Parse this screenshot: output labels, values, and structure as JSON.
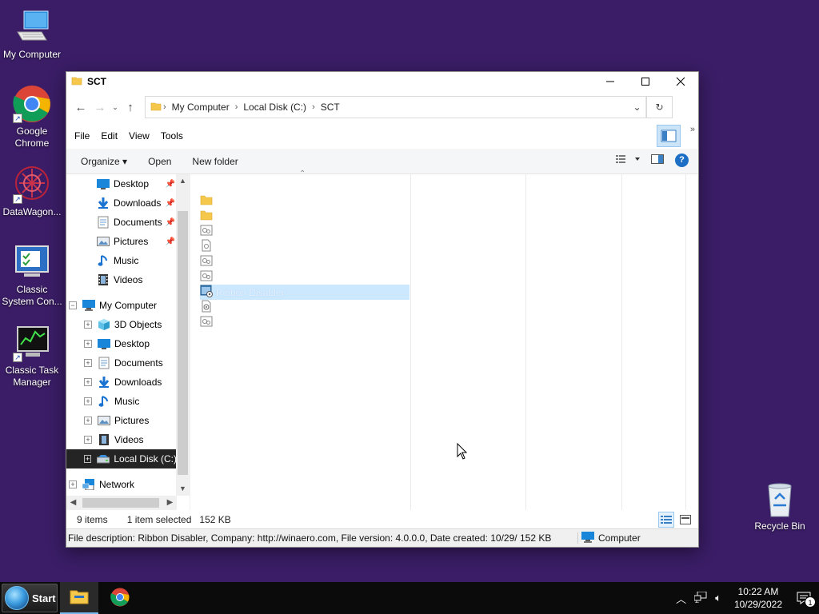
{
  "desktop": {
    "icons": [
      {
        "label": "My Computer",
        "icon": "computer-icon"
      },
      {
        "label": "Google Chrome",
        "icon": "chrome-icon"
      },
      {
        "label": "DataWagon...",
        "icon": "datawagon-icon"
      },
      {
        "label": "Classic System Con...",
        "icon": "control-panel-icon"
      },
      {
        "label": "Classic Task Manager",
        "icon": "task-manager-icon"
      },
      {
        "label": "Recycle Bin",
        "icon": "recycle-bin-icon"
      }
    ]
  },
  "window": {
    "title": "SCT",
    "controls": {
      "minimize": "—",
      "maximize": "☐",
      "close": "✕"
    },
    "address": {
      "crumbs": [
        "My Computer",
        "Local Disk (C:)",
        "SCT"
      ]
    },
    "menu": [
      "File",
      "Edit",
      "View",
      "Tools"
    ],
    "commands": {
      "organize": "Organize",
      "open": "Open",
      "new_folder": "New folder"
    },
    "nav": {
      "quick_access": [
        {
          "label": "Desktop",
          "icon": "desktop-icon",
          "pinned": true
        },
        {
          "label": "Downloads",
          "icon": "downloads-icon",
          "pinned": true
        },
        {
          "label": "Documents",
          "icon": "documents-icon",
          "pinned": true
        },
        {
          "label": "Pictures",
          "icon": "pictures-icon",
          "pinned": true
        },
        {
          "label": "Music",
          "icon": "music-icon",
          "pinned": false
        },
        {
          "label": "Videos",
          "icon": "videos-icon",
          "pinned": false
        }
      ],
      "my_computer": "My Computer",
      "computer_children": [
        {
          "label": "3D Objects",
          "icon": "3d-objects-icon"
        },
        {
          "label": "Desktop",
          "icon": "desktop-icon"
        },
        {
          "label": "Documents",
          "icon": "documents-icon"
        },
        {
          "label": "Downloads",
          "icon": "downloads-icon"
        },
        {
          "label": "Music",
          "icon": "music-icon"
        },
        {
          "label": "Pictures",
          "icon": "pictures-icon"
        },
        {
          "label": "Videos",
          "icon": "videos-icon"
        },
        {
          "label": "Local Disk (C:)",
          "icon": "drive-icon",
          "selected": true
        }
      ],
      "network": "Network"
    },
    "files": [
      {
        "type": "folder",
        "name": ""
      },
      {
        "type": "folder",
        "name": ""
      },
      {
        "type": "settings-file",
        "name": ""
      },
      {
        "type": "document",
        "name": ""
      },
      {
        "type": "settings-file",
        "name": ""
      },
      {
        "type": "settings-file",
        "name": ""
      },
      {
        "type": "exe",
        "name": "Ribbon Disabler",
        "selected": true
      },
      {
        "type": "ini",
        "name": ""
      },
      {
        "type": "settings-file",
        "name": ""
      }
    ],
    "status": {
      "count": "9 items",
      "selection": "1 item selected",
      "size": "152 KB"
    },
    "info": {
      "description": "File description: Ribbon Disabler, Company: http://winaero.com, File version: 4.0.0.0, Date created: 10/29/",
      "size": "152 KB",
      "location": "Computer"
    }
  },
  "taskbar": {
    "start_label": "Start",
    "time": "10:22 AM",
    "date": "10/29/2022",
    "notification_count": "1"
  }
}
